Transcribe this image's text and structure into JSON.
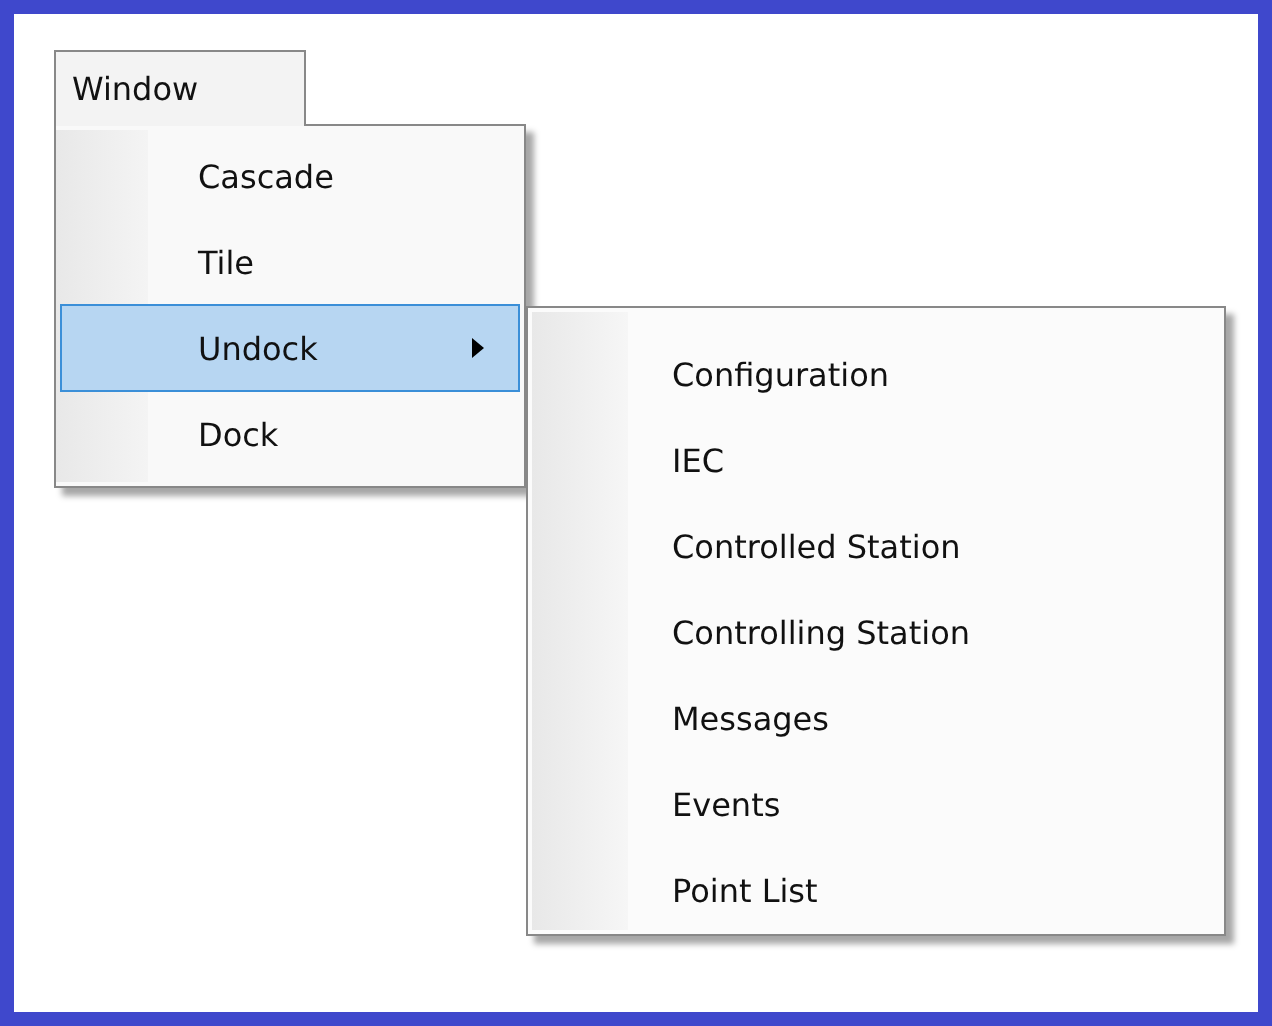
{
  "menu_bar": {
    "label": "Window",
    "selected": true
  },
  "menu": {
    "items": [
      {
        "label": "Cascade",
        "selected": false,
        "has_submenu": false
      },
      {
        "label": "Tile",
        "selected": false,
        "has_submenu": false
      },
      {
        "label": "Undock",
        "selected": true,
        "has_submenu": true
      },
      {
        "label": "Dock",
        "selected": false,
        "has_submenu": false
      }
    ]
  },
  "submenu": {
    "items": [
      {
        "label": "Configuration"
      },
      {
        "label": "IEC"
      },
      {
        "label": "Controlled Station"
      },
      {
        "label": "Controlling Station"
      },
      {
        "label": "Messages"
      },
      {
        "label": "Events"
      },
      {
        "label": "Point List"
      }
    ]
  }
}
